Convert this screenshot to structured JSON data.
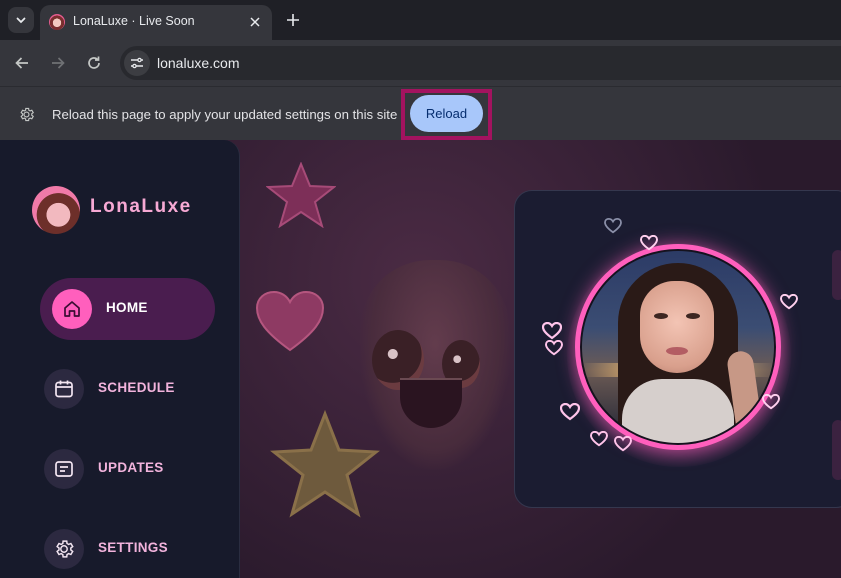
{
  "browser": {
    "tab": {
      "title": "LonaLuxe · Live Soon"
    },
    "address": {
      "url": "lonaluxe.com"
    },
    "infobar": {
      "message": "Reload this page to apply your updated settings on this site",
      "button_label": "Reload",
      "highlight_color": "#a3135f"
    }
  },
  "site": {
    "brand": {
      "name": "LonaLuxe"
    },
    "nav": [
      {
        "label": "HOME",
        "icon": "home-icon",
        "active": true
      },
      {
        "label": "SCHEDULE",
        "icon": "calendar-icon",
        "active": false
      },
      {
        "label": "UPDATES",
        "icon": "message-icon",
        "active": false
      },
      {
        "label": "SETTINGS",
        "icon": "gear-icon",
        "active": false
      }
    ],
    "accent_color": "#ff5fbd"
  }
}
